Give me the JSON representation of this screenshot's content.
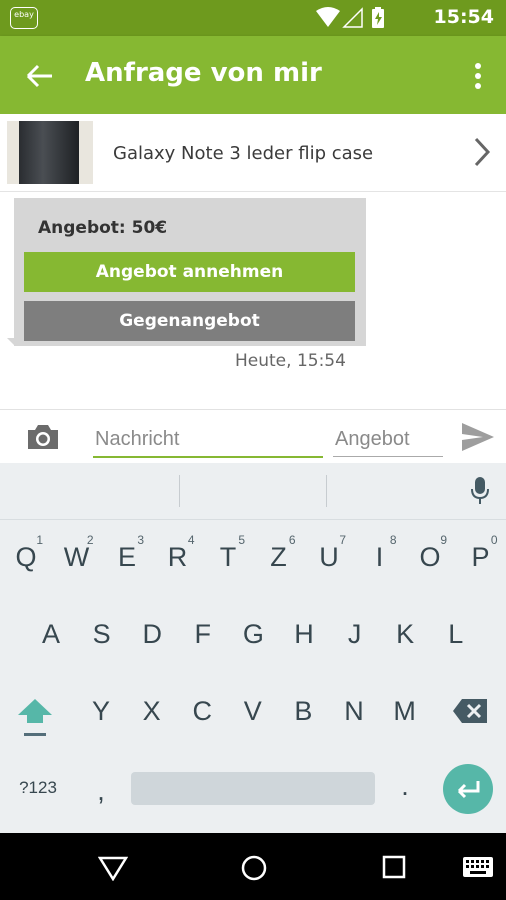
{
  "status_bar": {
    "time": "15:54",
    "logo_text": "ebay"
  },
  "app_bar": {
    "title": "Anfrage von mir"
  },
  "item": {
    "title": "Galaxy Note 3 leder flip case"
  },
  "message": {
    "offer": "Angebot: 50€",
    "accept_label": "Angebot annehmen",
    "counter_label": "Gegenangebot",
    "timestamp": "Heute, 15:54"
  },
  "compose": {
    "message_placeholder": "Nachricht",
    "offer_placeholder": "Angebot"
  },
  "keyboard": {
    "row1": [
      {
        "key": "Q",
        "hint": "1"
      },
      {
        "key": "W",
        "hint": "2"
      },
      {
        "key": "E",
        "hint": "3"
      },
      {
        "key": "R",
        "hint": "4"
      },
      {
        "key": "T",
        "hint": "5"
      },
      {
        "key": "Z",
        "hint": "6"
      },
      {
        "key": "U",
        "hint": "7"
      },
      {
        "key": "I",
        "hint": "8"
      },
      {
        "key": "O",
        "hint": "9"
      },
      {
        "key": "P",
        "hint": "0"
      }
    ],
    "row2": [
      "A",
      "S",
      "D",
      "F",
      "G",
      "H",
      "J",
      "K",
      "L"
    ],
    "row3": [
      "Y",
      "X",
      "C",
      "V",
      "B",
      "N",
      "M"
    ],
    "symbols_label": "?123",
    "comma": ",",
    "period": "."
  },
  "colors": {
    "accent": "#86b832",
    "status_bar": "#6e9a1e",
    "counter_button": "#7e7e7e",
    "enter_key": "#56b7a8"
  }
}
